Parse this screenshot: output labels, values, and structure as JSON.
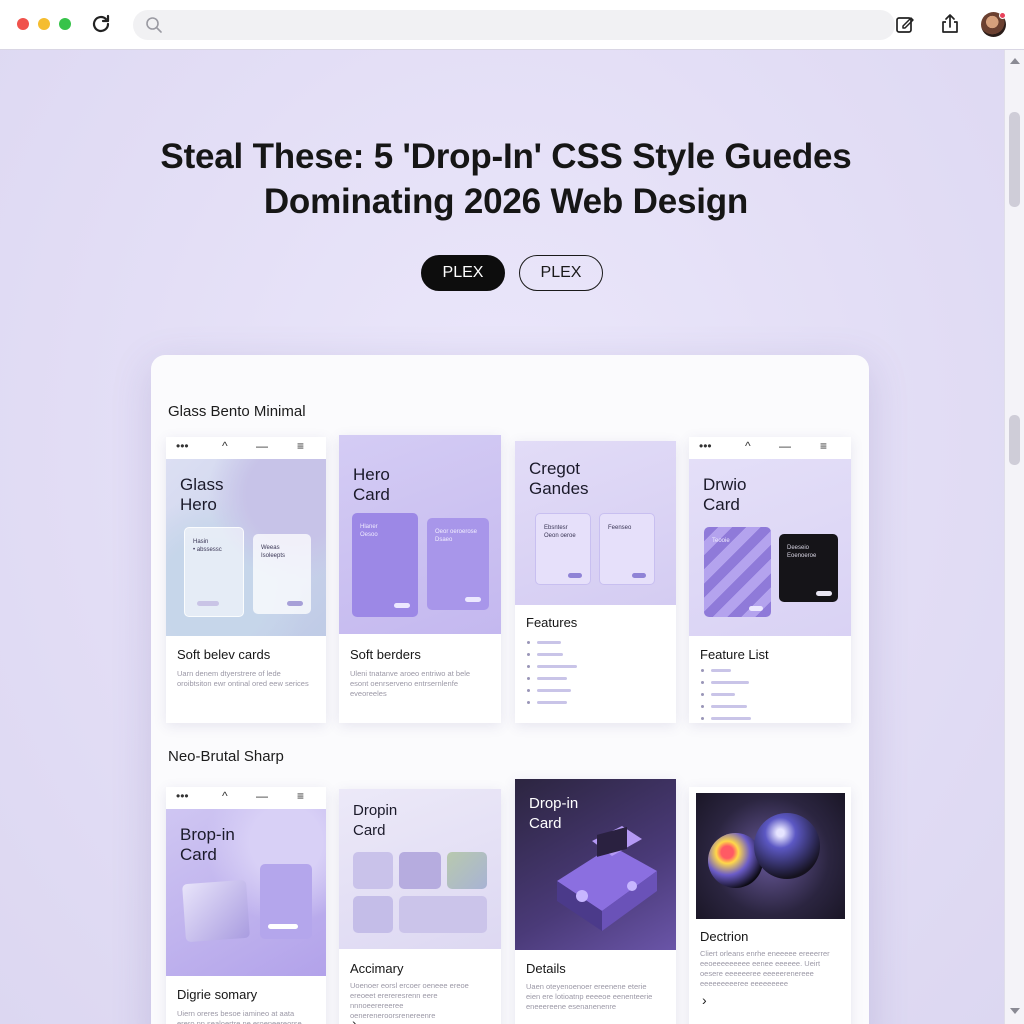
{
  "browser": {
    "address_placeholder": "",
    "icons": [
      "reload-icon",
      "search-icon",
      "edit-icon",
      "share-icon",
      "avatar"
    ]
  },
  "page": {
    "title_line1": "Steal These: 5 'Drop-In' CSS Style Guedes",
    "title_line2": "Dominating 2026 Web Design",
    "pill_primary": "PLEX",
    "pill_secondary": "PLEX"
  },
  "sections": [
    {
      "label": "Glass Bento Minimal",
      "cards": [
        {
          "hero_title": "Glass\nHero",
          "mini1": "Hasin\n• abssessc",
          "mini2": "Weeas\nIsoleepts",
          "title": "Soft belev cards",
          "body": "Uarn denem dtyerstrere of lede oroibtsiton ewr ontinal ored eew serices",
          "nav": [
            "•••",
            "^",
            "—",
            "≡"
          ]
        },
        {
          "hero_title": "Hero\nCard",
          "mini1": "Hlaner\nOesoo",
          "mini2": "Oeor oeroerose\nDsaeo",
          "title": "Soft berders",
          "body": "Uleni tnatanve aroeo entriwo at bele esont oenrserveno entrsernlenfe eveoreeles"
        },
        {
          "hero_title": "Cregot\nGandes",
          "mini1": "Ebsntesr\nOeon oeroe",
          "mini2": "Feenseo",
          "title": "Features"
        },
        {
          "hero_title": "Drwio\nCard",
          "mini1": "Teooie",
          "mini2": "Deeseio\nEoenoeroe",
          "title": "Feature List",
          "nav": [
            "•••",
            "^",
            "—",
            "≡"
          ]
        }
      ]
    },
    {
      "label": "Neo-Brutal Sharp",
      "cards": [
        {
          "hero_title": "Brop-in\nCard",
          "title": "Digrie somary",
          "body": "Uiern oreres besoe iamineo at aata erero nn sealoertre ne eroeneereorse",
          "nav": [
            "•••",
            "^",
            "—",
            "≡"
          ]
        },
        {
          "hero_title": "Dropin\nCard",
          "title": "Accimary",
          "body": "Uoenoer eorsl ercoer oeneee ereoe ereoeet erereresrenn eere nnnoeerereeree oenereneroorsrenereenre"
        },
        {
          "hero_title": "Drop-in\nCard",
          "title": "Details",
          "body": "Uaen oteyenoenoer ereenene eterie eien ere lotioatnp eeeeoe eenenteerie eneeereene esenanenenre"
        },
        {
          "title": "Dectrion",
          "body": "Cliert orleans enrhe eneeeee ereeerrer eeoeeeeeeeee eenee eeeeee. Ueirt oesere eeeeeeree eeeeerenereee eeeeeeeeeree eeeeeeeee"
        }
      ]
    }
  ]
}
